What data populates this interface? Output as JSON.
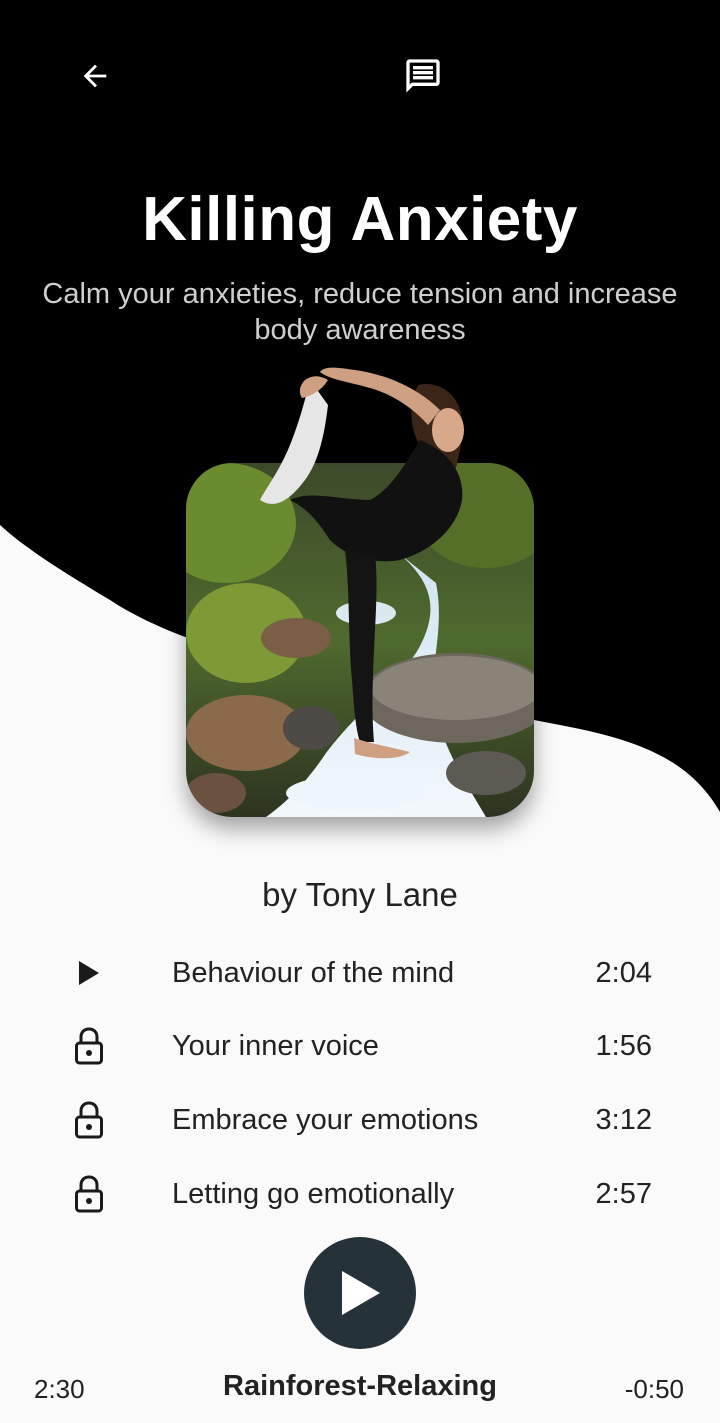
{
  "colors": {
    "header_bg": "#000000",
    "page_bg": "#fafafa",
    "play_button": "#26323a"
  },
  "header": {
    "back_icon": "arrow-left-icon",
    "chat_icon": "message-icon",
    "title": "Killing Anxiety",
    "subtitle": "Calm your anxieties, reduce tension and increase body awareness"
  },
  "artwork": {
    "subject": "yoga-pose-over-river"
  },
  "author": "by Tony Lane",
  "tracks": [
    {
      "icon": "play-icon",
      "title": "Behaviour of the mind",
      "duration": "2:04"
    },
    {
      "icon": "lock-icon",
      "title": "Your inner voice",
      "duration": "1:56"
    },
    {
      "icon": "lock-icon",
      "title": "Embrace your emotions",
      "duration": "3:12"
    },
    {
      "icon": "lock-icon",
      "title": "Letting go emotionally",
      "duration": "2:57"
    }
  ],
  "player": {
    "elapsed": "2:30",
    "remaining": "-0:50",
    "now_playing": "Rainforest-Relaxing",
    "play_icon": "play-icon"
  }
}
